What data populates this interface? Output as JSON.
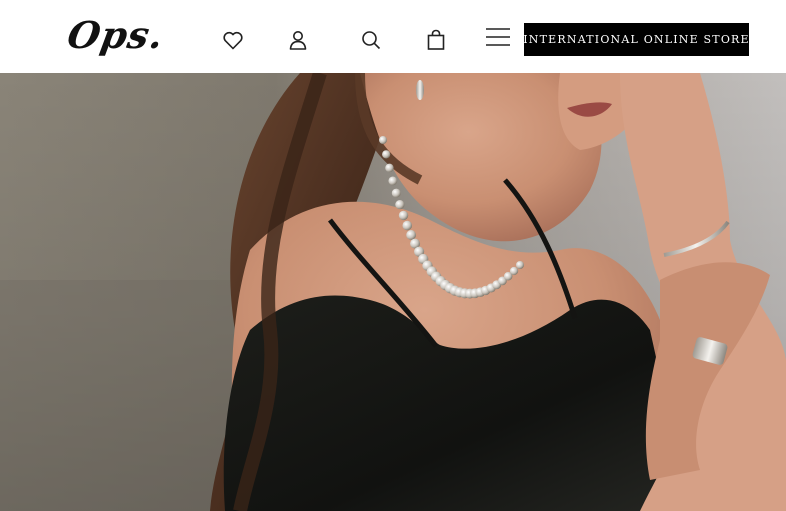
{
  "header": {
    "logo_text": "Ops.",
    "store_button_label": "INTERNATIONAL ONLINE STORE",
    "icons": [
      "heart-icon",
      "user-icon",
      "search-icon",
      "shopping-bag-icon",
      "hamburger-menu-icon"
    ]
  },
  "hero": {
    "image": "photo-woman-pearl-necklace-black-camisole"
  },
  "colors": {
    "header_bg": "#ffffff",
    "button_bg": "#000000",
    "button_text": "#ffffff",
    "icon_stroke": "#222222"
  }
}
